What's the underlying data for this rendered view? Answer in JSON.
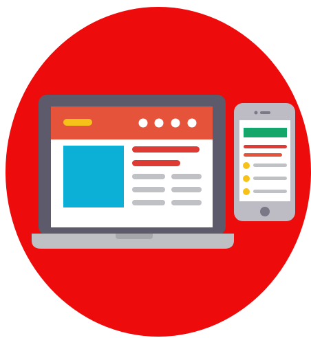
{
  "illustration": {
    "subject": "responsive-web-design",
    "devices": [
      "laptop",
      "smartphone"
    ],
    "colors": {
      "background_circle": "#ee0b0b",
      "laptop_bezel": "#5d5a6c",
      "laptop_base": "#bfc0c4",
      "laptop_base_shadow": "#a6a7ab",
      "phone_body": "#bdbcc4",
      "screen_white": "#ffffff",
      "header_orange": "#e5543a",
      "logo_yellow": "#f6c21a",
      "image_cyan": "#0cb0d6",
      "text_red": "#de3b34",
      "text_gray": "#c0c1c5",
      "phone_header_green": "#14a66a",
      "bullet_yellow": "#f6c21a",
      "phone_button": "#7a7887"
    },
    "icons": {
      "laptop": "laptop-icon",
      "smartphone": "smartphone-icon",
      "menu_dots": "menu-dots-icon",
      "home_button": "home-button-icon"
    }
  }
}
